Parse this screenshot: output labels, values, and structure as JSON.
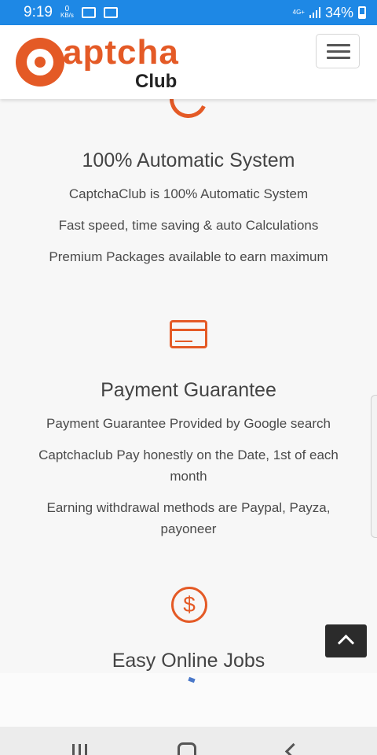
{
  "status_bar": {
    "time": "9:19",
    "net_speed_value": "0",
    "net_speed_unit": "KB/s",
    "network": "4G+",
    "battery": "34%"
  },
  "header": {
    "logo_main": "aptcha",
    "logo_sub": "Club"
  },
  "features": [
    {
      "title": "100% Automatic System",
      "lines": [
        "CaptchaClub is 100% Automatic System",
        "Fast speed, time saving & auto Calculations",
        "Premium Packages available to earn maximum"
      ]
    },
    {
      "title": "Payment Guarantee",
      "lines": [
        "Payment Guarantee Provided by Google search",
        "Captchaclub Pay honestly on the Date, 1st of each",
        "month",
        "Earning withdrawal methods are Paypal, Payza,",
        "payoneer"
      ]
    },
    {
      "title": "Easy Online Jobs",
      "icon_glyph": "$"
    }
  ],
  "colors": {
    "status_bar": "#1e88e5",
    "brand_orange": "#e45a26",
    "text": "#444444"
  }
}
